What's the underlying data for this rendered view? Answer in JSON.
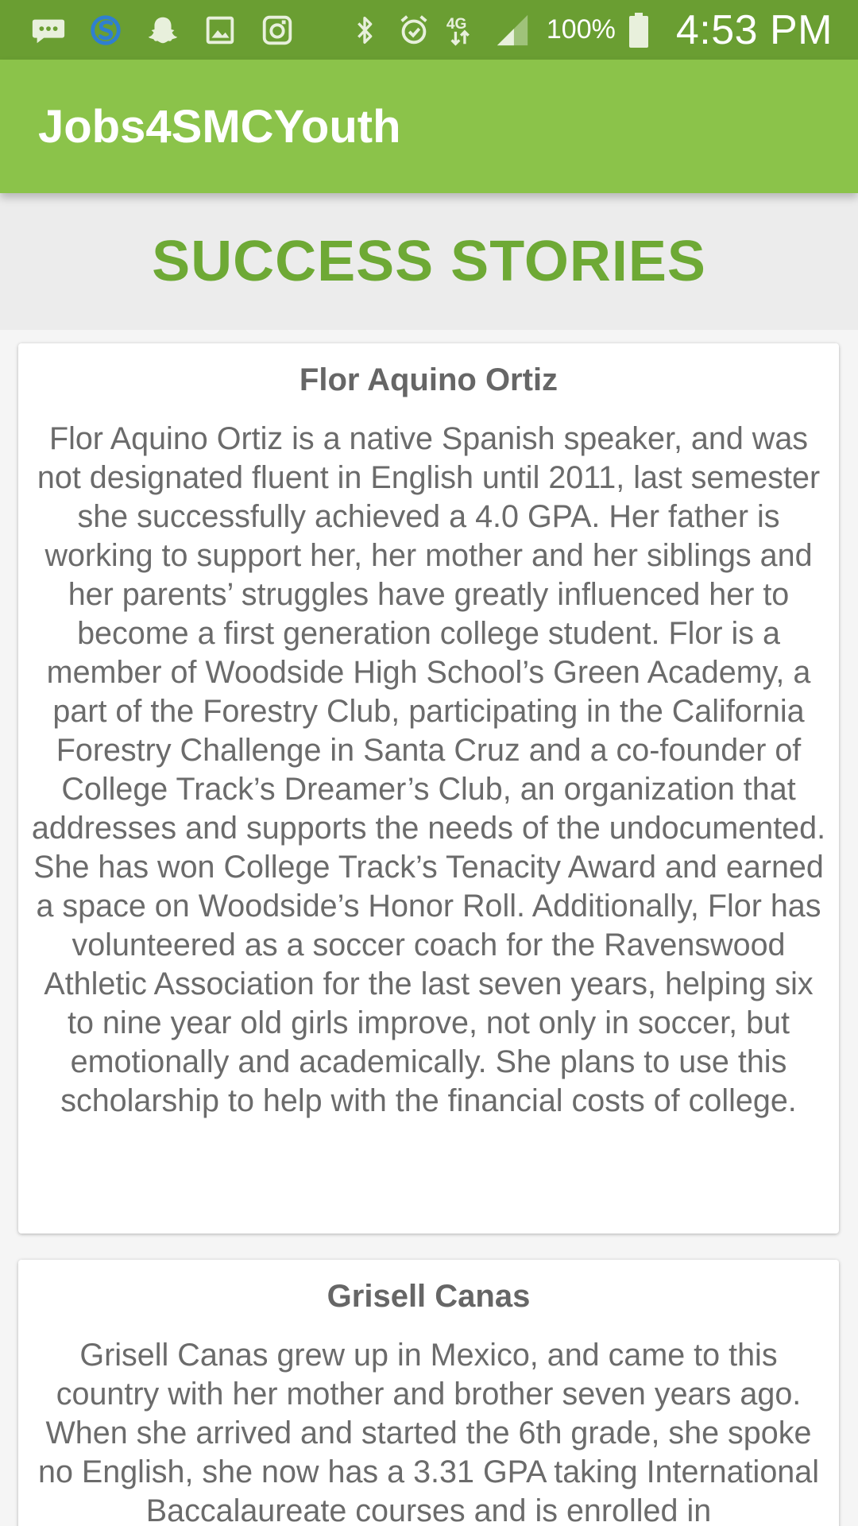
{
  "status_bar": {
    "icons_left": [
      "message-icon",
      "sync-icon",
      "snapchat-icon",
      "gallery-icon",
      "instagram-icon"
    ],
    "icons_right": [
      "bluetooth-icon",
      "alarm-icon",
      "lte-icon",
      "signal-icon"
    ],
    "battery_text": "100%",
    "time": "4:53 PM",
    "color": "#6a9e32"
  },
  "app_bar": {
    "title": "Jobs4SMCYouth",
    "color": "#8bc34a"
  },
  "page": {
    "heading": "SUCCESS STORIES",
    "heading_color": "#6ea935"
  },
  "stories": [
    {
      "name": "Flor Aquino Ortiz",
      "text": "Flor Aquino Ortiz is a native Spanish speaker, and was not designated fluent in English until 2011, last semester she successfully achieved a 4.0 GPA. Her father is working to support her, her mother and her siblings and her parents’ struggles have greatly influenced her to become a first generation college student. Flor is a member of Woodside High School’s Green Academy, a part of the Forestry Club, participating in the California Forestry Challenge in Santa Cruz and a co-founder of College Track’s Dreamer’s Club, an organization that addresses and supports the needs of the undocumented. She has won College Track’s Tenacity Award and earned a space on Woodside’s Honor Roll. Additionally, Flor has volunteered as a soccer coach for the Ravenswood Athletic Association for the last seven years, helping six to nine year old girls improve, not only in soccer, but emotionally and academically. She plans to use this scholarship to help with the financial costs of college."
    },
    {
      "name": "Grisell Canas",
      "text": "Grisell Canas grew up in Mexico, and came to this country with her mother and brother seven years ago. When she arrived and started the 6th grade, she spoke no English, she now has a 3.31 GPA taking International Baccalaureate courses and is enrolled in"
    }
  ]
}
